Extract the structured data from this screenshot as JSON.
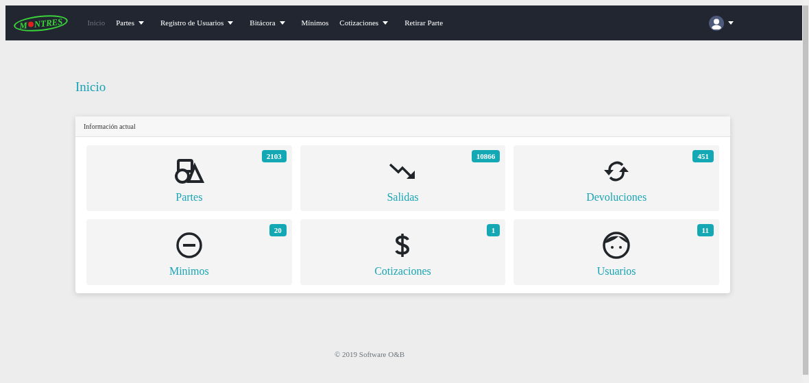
{
  "logo": {
    "text_before": "M",
    "text_after": "NTRES"
  },
  "nav": [
    {
      "label": "Inicio",
      "selected": true,
      "dropdown": false
    },
    {
      "label": "Partes",
      "selected": false,
      "dropdown": true
    },
    {
      "label": "Registro de Usuarios",
      "selected": false,
      "dropdown": true
    },
    {
      "label": "Bitácora",
      "selected": false,
      "dropdown": true
    },
    {
      "label": "Mínimos",
      "selected": false,
      "dropdown": false
    },
    {
      "label": "Cotizaciones",
      "selected": false,
      "dropdown": true
    },
    {
      "label": "Retirar Parte",
      "selected": false,
      "dropdown": false
    }
  ],
  "page_title": "Inicio",
  "panel": {
    "title": "Información actual",
    "tiles": [
      {
        "kind": "shapes",
        "label": "Partes",
        "count": "2103"
      },
      {
        "kind": "trend-down",
        "label": "Salidas",
        "count": "10866"
      },
      {
        "kind": "sync",
        "label": "Devoluciones",
        "count": "451"
      },
      {
        "kind": "minus-circle",
        "label": "Minimos",
        "count": "20"
      },
      {
        "kind": "dollar",
        "label": "Cotizaciones",
        "count": "1"
      },
      {
        "kind": "face",
        "label": "Usuarios",
        "count": "11"
      }
    ]
  },
  "footer": "© 2019 Software O&B"
}
